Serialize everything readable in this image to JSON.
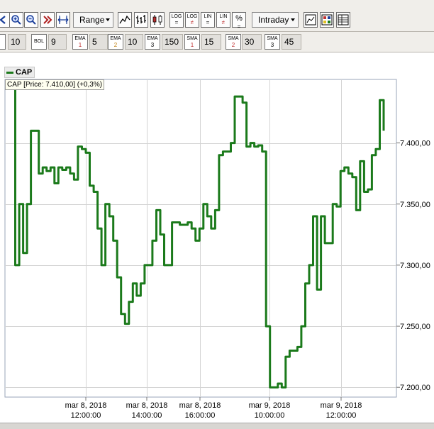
{
  "toolbar": {
    "range_label": "Range",
    "interval_label": "Intraday",
    "log_label": "LOG",
    "lin_label": "LIN",
    "percent_label": "%"
  },
  "indicators": [
    {
      "name": "BOL",
      "sub": "",
      "value": "9"
    },
    {
      "name": "EMA",
      "sub": "1",
      "value": "5"
    },
    {
      "name": "EMA",
      "sub": "2",
      "value": "10"
    },
    {
      "name": "EMA",
      "sub": "3",
      "value": "150"
    },
    {
      "name": "SMA",
      "sub": "1",
      "value": "15"
    },
    {
      "name": "SMA",
      "sub": "2",
      "value": "30"
    },
    {
      "name": "SMA",
      "sub": "3",
      "value": "45"
    }
  ],
  "first_indicator_value": "10",
  "colors": {
    "line": "#1b7a1b",
    "grid": "#d4d4d4",
    "toolbar": "#f0eeea",
    "accent_red": "#c03030"
  },
  "chart_data": {
    "type": "line",
    "series": [
      {
        "name": "CAP",
        "values": [
          7.448,
          7.3,
          7.35,
          7.31,
          7.35,
          7.41,
          7.41,
          7.375,
          7.38,
          7.377,
          7.38,
          7.367,
          7.38,
          7.378,
          7.38,
          7.375,
          7.37,
          7.397,
          7.395,
          7.392,
          7.365,
          7.36,
          7.33,
          7.3,
          7.35,
          7.34,
          7.32,
          7.29,
          7.26,
          7.252,
          7.27,
          7.285,
          7.275,
          7.285,
          7.3,
          7.3,
          7.32,
          7.345,
          7.325,
          7.3,
          7.3,
          7.335,
          7.335,
          7.333,
          7.333,
          7.335,
          7.33,
          7.32,
          7.33,
          7.35,
          7.34,
          7.33,
          7.345,
          7.39,
          7.393,
          7.393,
          7.4,
          7.438,
          7.438,
          7.433,
          7.397,
          7.4,
          7.397,
          7.398,
          7.393,
          7.25,
          7.2,
          7.2,
          7.203,
          7.2,
          7.225,
          7.23,
          7.23,
          7.233,
          7.25,
          7.285,
          7.3,
          7.34,
          7.28,
          7.34,
          7.318,
          7.318,
          7.35,
          7.348,
          7.377,
          7.38,
          7.375,
          7.372,
          7.345,
          7.385,
          7.36,
          7.362,
          7.39,
          7.395,
          7.435,
          7.41
        ]
      }
    ],
    "price_label": "CAP [Price: 7.410,00] (+0,3%)",
    "y_ticks": [
      "7.400,00",
      "7.350,00",
      "7.300,00",
      "7.250,00",
      "7.200,00"
    ],
    "y_tick_values": [
      7.4,
      7.35,
      7.3,
      7.25,
      7.2
    ],
    "ylim": [
      7.192,
      7.452
    ],
    "x_ticks": [
      {
        "date": "mar 8, 2018",
        "time": "12:00:00"
      },
      {
        "date": "mar 8, 2018",
        "time": "14:00:00"
      },
      {
        "date": "mar 8, 2018",
        "time": "16:00:00"
      },
      {
        "date": "mar 9, 2018",
        "time": "10:00:00"
      },
      {
        "date": "mar 9, 2018",
        "time": "12:00:00"
      }
    ],
    "grid": true,
    "legend": "top-left"
  }
}
